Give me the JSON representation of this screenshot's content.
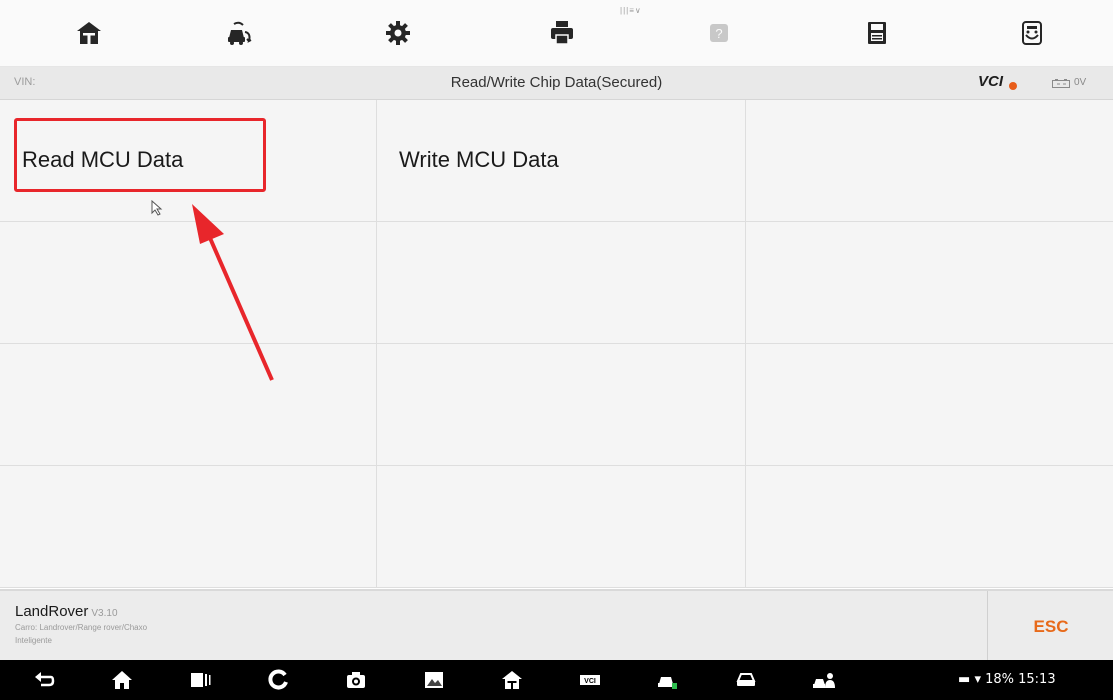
{
  "toolbar": {
    "hint": "|||≡∨",
    "buttons": [
      {
        "name": "home-icon"
      },
      {
        "name": "vehicle-swap-icon"
      },
      {
        "name": "settings-gear-icon"
      },
      {
        "name": "print-icon"
      },
      {
        "name": "help-icon"
      },
      {
        "name": "save-icon"
      },
      {
        "name": "data-logging-icon"
      }
    ]
  },
  "titlebar": {
    "vin_label": "VIN:",
    "title": "Read/Write Chip Data(Secured)",
    "vci_label": "VCI",
    "voltage": "0V"
  },
  "grid": {
    "items": [
      {
        "label": "Read MCU Data",
        "selected": true
      },
      {
        "label": "Write MCU Data",
        "selected": false
      }
    ]
  },
  "infobar": {
    "brand": "LandRover",
    "version": "V3.10",
    "path_line1": "Carro: Landrover/Range rover/Chaxo",
    "path_line2": "Inteligente",
    "esc_label": "ESC"
  },
  "navbar": {
    "status_text": "18% 15:13"
  },
  "colors": {
    "highlight": "#e8262b",
    "accent": "#e86a1a"
  }
}
